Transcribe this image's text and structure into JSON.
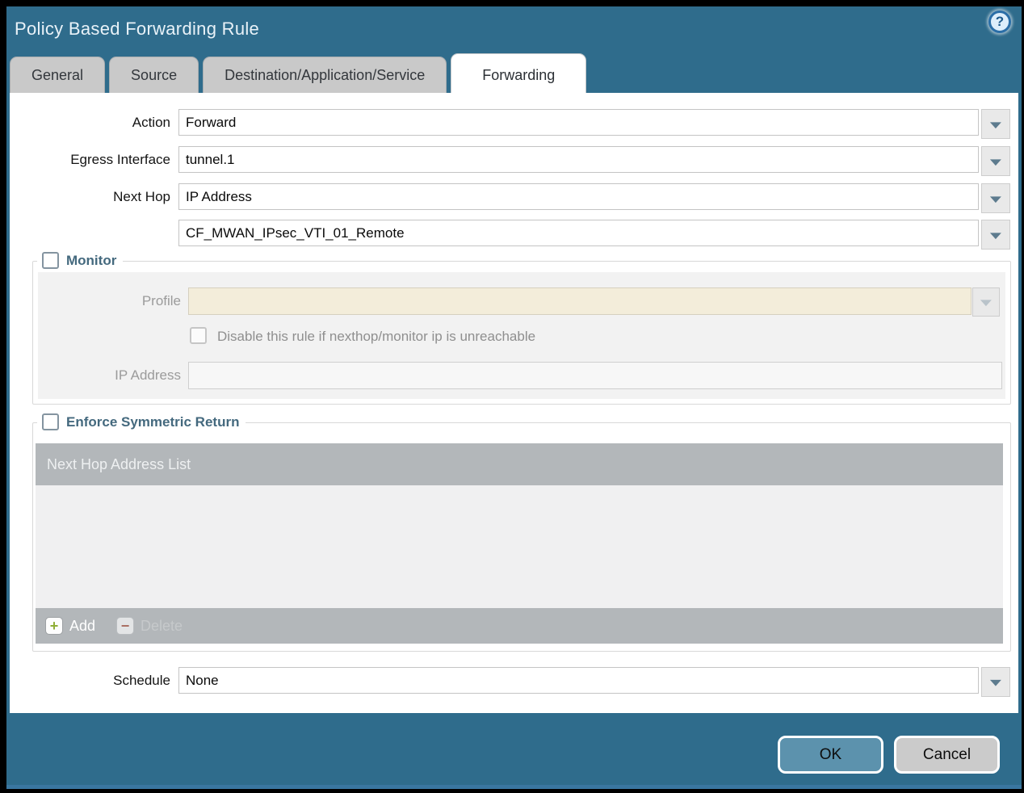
{
  "dialog": {
    "title": "Policy Based Forwarding Rule",
    "tabs": [
      {
        "label": "General",
        "active": false
      },
      {
        "label": "Source",
        "active": false
      },
      {
        "label": "Destination/Application/Service",
        "active": false
      },
      {
        "label": "Forwarding",
        "active": true
      }
    ]
  },
  "form": {
    "action": {
      "label": "Action",
      "value": "Forward"
    },
    "egress_interface": {
      "label": "Egress Interface",
      "value": "tunnel.1"
    },
    "next_hop": {
      "label": "Next Hop",
      "value": "IP Address"
    },
    "next_hop_address": {
      "value": "CF_MWAN_IPsec_VTI_01_Remote"
    },
    "monitor": {
      "legend": "Monitor",
      "checked": false,
      "profile": {
        "label": "Profile",
        "value": "",
        "disabled": true
      },
      "disable_rule": {
        "label": "Disable this rule if nexthop/monitor ip is unreachable",
        "checked": false,
        "disabled": true
      },
      "ip_address": {
        "label": "IP Address",
        "value": "",
        "disabled": true
      }
    },
    "enforce_symmetric_return": {
      "legend": "Enforce Symmetric Return",
      "checked": false,
      "table": {
        "header": "Next Hop Address List",
        "rows": []
      },
      "add_label": "Add",
      "delete_label": "Delete",
      "delete_disabled": true
    },
    "schedule": {
      "label": "Schedule",
      "value": "None"
    }
  },
  "footer": {
    "ok_label": "OK",
    "cancel_label": "Cancel"
  },
  "icons": {
    "help": "?",
    "chevron_down": "▼",
    "plus": "+",
    "minus": "−"
  },
  "colors": {
    "titlebar_teal": "#2f6c8c",
    "bottom_strip_blue": "#3a76a0",
    "ok_button_blue": "#5c92ad",
    "cancel_button_gray": "#cbcbcb",
    "disabled_field_beige": "#f3edda",
    "table_gray": "#b3b7ba",
    "legend_slate": "#44697e",
    "add_icon_green": "#8fae36",
    "delete_icon_red": "#a96e62"
  }
}
